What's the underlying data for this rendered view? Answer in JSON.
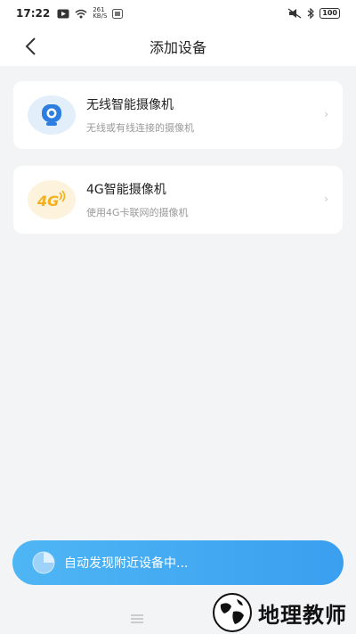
{
  "status_bar": {
    "time": "17:22",
    "net_speed_top": "261",
    "net_speed_bottom": "KB/S",
    "battery": "100"
  },
  "header": {
    "title": "添加设备"
  },
  "devices": [
    {
      "title": "无线智能摄像机",
      "subtitle": "无线或有线连接的摄像机",
      "icon": "camera-icon",
      "icon_bg": "#e3eefb"
    },
    {
      "title": "4G智能摄像机",
      "subtitle": "使用4G卡联网的摄像机",
      "icon": "4g-icon",
      "icon_bg": "#fdf2dc"
    }
  ],
  "scan": {
    "text": "自动发现附近设备中..."
  },
  "watermark": {
    "text": "地理教师"
  },
  "colors": {
    "accent": "#3a9fef",
    "camera_blue": "#2e7de0",
    "fourg_orange": "#f2b01e"
  }
}
